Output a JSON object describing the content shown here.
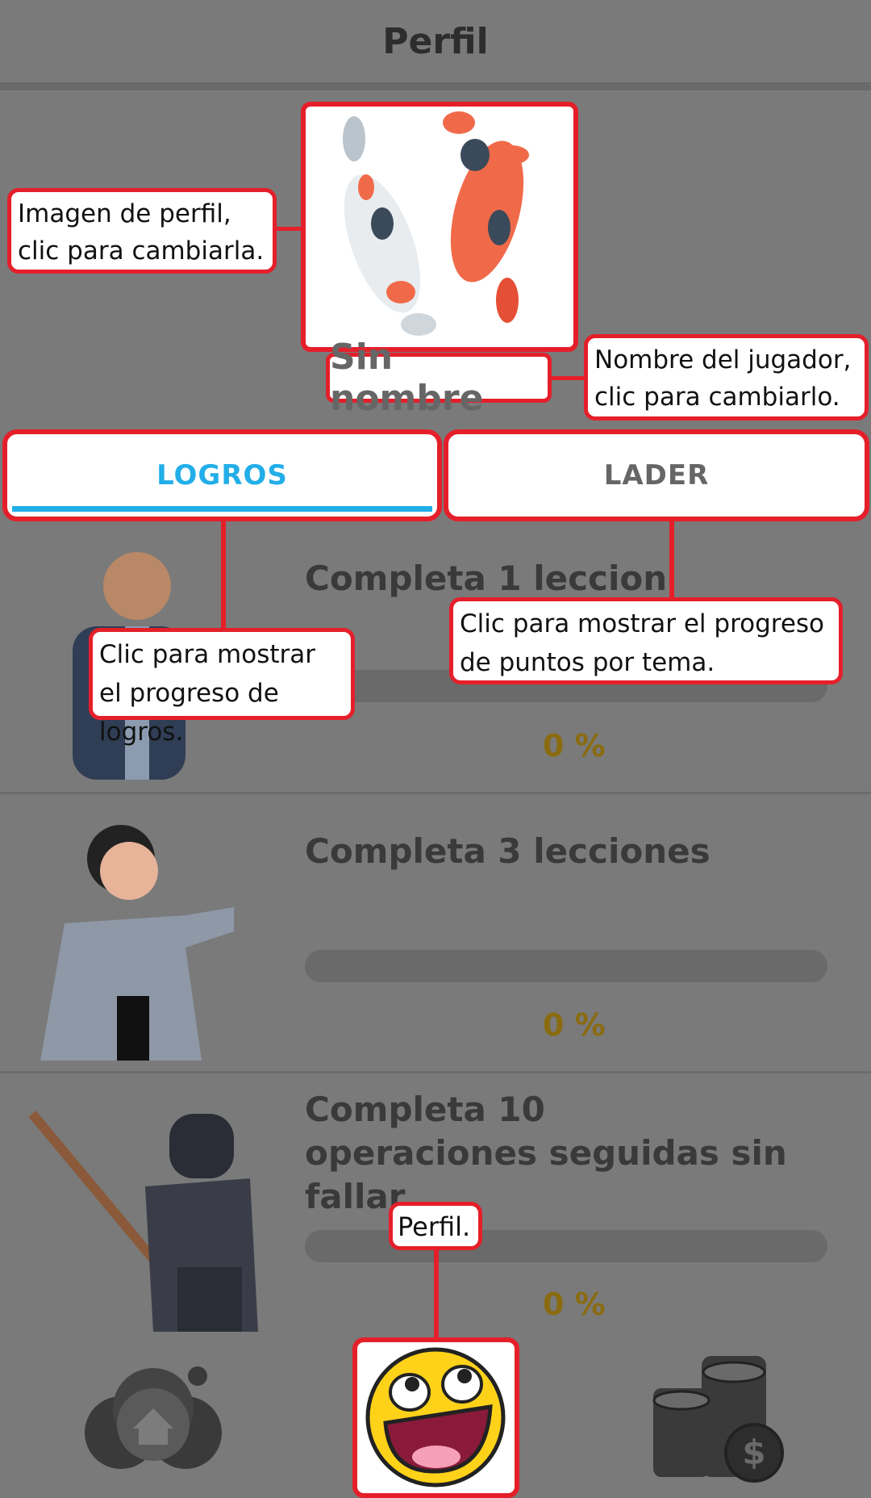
{
  "header": {
    "title": "Perfil"
  },
  "profile": {
    "avatar_icon": "koi-fish-image",
    "player_name": "Sin nombre"
  },
  "tabs": [
    {
      "label": "LOGROS",
      "active": true
    },
    {
      "label": "LADER",
      "active": false
    }
  ],
  "achievements": [
    {
      "title": "Completa 1 leccion",
      "progress_label": "0 %",
      "progress": 0,
      "image": "bald-monk-image"
    },
    {
      "title": "Completa 3 lecciones",
      "progress_label": "0 %",
      "progress": 0,
      "image": "karateka-image"
    },
    {
      "title": "Completa 10 operaciones seguidas sin fallar",
      "progress_label": "0 %",
      "progress": 0,
      "image": "kendo-fighter-image"
    }
  ],
  "callouts": {
    "profile_image": "Imagen de perfil, clic para cambiarla.",
    "player_name": "Nombre del jugador, clic para cambiarlo.",
    "tab_logros": "Clic para mostrar el progreso de logros.",
    "tab_lader": "Clic para mostrar el progreso de puntos por tema.",
    "nav_profile": "Perfil."
  },
  "bottom_nav": [
    {
      "icon": "home-icon"
    },
    {
      "icon": "smiley-face-icon",
      "active": true
    },
    {
      "icon": "coins-icon"
    }
  ],
  "colors": {
    "accent": "#22aee8",
    "highlight_border": "#e51f2a",
    "progress_text": "#8a6b10"
  }
}
